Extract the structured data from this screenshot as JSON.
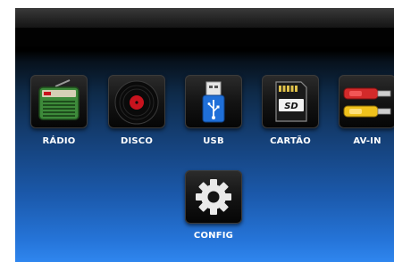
{
  "menu": {
    "items": [
      {
        "label": "RÁDIO",
        "icon": "radio-icon"
      },
      {
        "label": "DISCO",
        "icon": "vinyl-disc-icon"
      },
      {
        "label": "USB",
        "icon": "usb-drive-icon"
      },
      {
        "label": "CARTÃO",
        "icon": "sd-card-icon"
      },
      {
        "label": "AV-IN",
        "icon": "rca-cables-icon"
      },
      {
        "label": "CONFIG",
        "icon": "gear-icon"
      }
    ]
  },
  "colors": {
    "background_top": "#000000",
    "background_bottom": "#2f86ef",
    "label_text": "#ffffff",
    "radio_green": "#3d8a3a",
    "disc_red": "#c8131e",
    "usb_blue": "#1f6fd8",
    "rca_red": "#d32a2a",
    "rca_yellow": "#f0c21c"
  }
}
